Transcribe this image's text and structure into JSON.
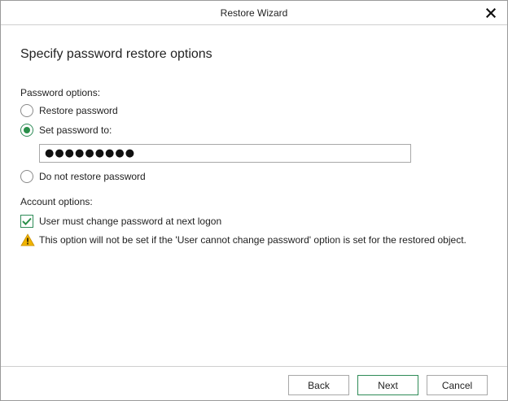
{
  "window": {
    "title": "Restore Wizard",
    "close_icon": "close-icon"
  },
  "page": {
    "heading": "Specify password restore options"
  },
  "password_options": {
    "label": "Password options:",
    "options": [
      {
        "label": "Restore password",
        "selected": false
      },
      {
        "label": "Set password to:",
        "selected": true
      },
      {
        "label": "Do not restore password",
        "selected": false
      }
    ],
    "password_value": "●●●●●●●●●"
  },
  "account_options": {
    "label": "Account options:",
    "must_change_label": "User must change password at next logon",
    "must_change_checked": true,
    "warning_icon": "warning-icon",
    "warning_text": "This option will not be set if the 'User cannot change password' option is set for the restored object."
  },
  "footer": {
    "back_label": "Back",
    "next_label": "Next",
    "cancel_label": "Cancel"
  },
  "colors": {
    "accent": "#2a8f4a",
    "warning": "#f0b400"
  }
}
